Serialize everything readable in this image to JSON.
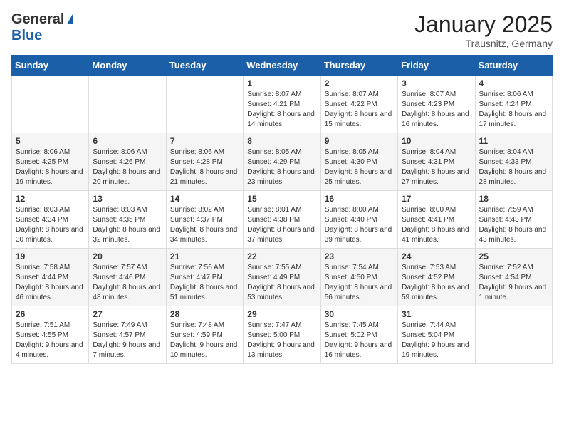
{
  "logo": {
    "general": "General",
    "blue": "Blue"
  },
  "title": "January 2025",
  "location": "Trausnitz, Germany",
  "days_header": [
    "Sunday",
    "Monday",
    "Tuesday",
    "Wednesday",
    "Thursday",
    "Friday",
    "Saturday"
  ],
  "weeks": [
    [
      {
        "num": "",
        "info": ""
      },
      {
        "num": "",
        "info": ""
      },
      {
        "num": "",
        "info": ""
      },
      {
        "num": "1",
        "info": "Sunrise: 8:07 AM\nSunset: 4:21 PM\nDaylight: 8 hours\nand 14 minutes."
      },
      {
        "num": "2",
        "info": "Sunrise: 8:07 AM\nSunset: 4:22 PM\nDaylight: 8 hours\nand 15 minutes."
      },
      {
        "num": "3",
        "info": "Sunrise: 8:07 AM\nSunset: 4:23 PM\nDaylight: 8 hours\nand 16 minutes."
      },
      {
        "num": "4",
        "info": "Sunrise: 8:06 AM\nSunset: 4:24 PM\nDaylight: 8 hours\nand 17 minutes."
      }
    ],
    [
      {
        "num": "5",
        "info": "Sunrise: 8:06 AM\nSunset: 4:25 PM\nDaylight: 8 hours\nand 19 minutes."
      },
      {
        "num": "6",
        "info": "Sunrise: 8:06 AM\nSunset: 4:26 PM\nDaylight: 8 hours\nand 20 minutes."
      },
      {
        "num": "7",
        "info": "Sunrise: 8:06 AM\nSunset: 4:28 PM\nDaylight: 8 hours\nand 21 minutes."
      },
      {
        "num": "8",
        "info": "Sunrise: 8:05 AM\nSunset: 4:29 PM\nDaylight: 8 hours\nand 23 minutes."
      },
      {
        "num": "9",
        "info": "Sunrise: 8:05 AM\nSunset: 4:30 PM\nDaylight: 8 hours\nand 25 minutes."
      },
      {
        "num": "10",
        "info": "Sunrise: 8:04 AM\nSunset: 4:31 PM\nDaylight: 8 hours\nand 27 minutes."
      },
      {
        "num": "11",
        "info": "Sunrise: 8:04 AM\nSunset: 4:33 PM\nDaylight: 8 hours\nand 28 minutes."
      }
    ],
    [
      {
        "num": "12",
        "info": "Sunrise: 8:03 AM\nSunset: 4:34 PM\nDaylight: 8 hours\nand 30 minutes."
      },
      {
        "num": "13",
        "info": "Sunrise: 8:03 AM\nSunset: 4:35 PM\nDaylight: 8 hours\nand 32 minutes."
      },
      {
        "num": "14",
        "info": "Sunrise: 8:02 AM\nSunset: 4:37 PM\nDaylight: 8 hours\nand 34 minutes."
      },
      {
        "num": "15",
        "info": "Sunrise: 8:01 AM\nSunset: 4:38 PM\nDaylight: 8 hours\nand 37 minutes."
      },
      {
        "num": "16",
        "info": "Sunrise: 8:00 AM\nSunset: 4:40 PM\nDaylight: 8 hours\nand 39 minutes."
      },
      {
        "num": "17",
        "info": "Sunrise: 8:00 AM\nSunset: 4:41 PM\nDaylight: 8 hours\nand 41 minutes."
      },
      {
        "num": "18",
        "info": "Sunrise: 7:59 AM\nSunset: 4:43 PM\nDaylight: 8 hours\nand 43 minutes."
      }
    ],
    [
      {
        "num": "19",
        "info": "Sunrise: 7:58 AM\nSunset: 4:44 PM\nDaylight: 8 hours\nand 46 minutes."
      },
      {
        "num": "20",
        "info": "Sunrise: 7:57 AM\nSunset: 4:46 PM\nDaylight: 8 hours\nand 48 minutes."
      },
      {
        "num": "21",
        "info": "Sunrise: 7:56 AM\nSunset: 4:47 PM\nDaylight: 8 hours\nand 51 minutes."
      },
      {
        "num": "22",
        "info": "Sunrise: 7:55 AM\nSunset: 4:49 PM\nDaylight: 8 hours\nand 53 minutes."
      },
      {
        "num": "23",
        "info": "Sunrise: 7:54 AM\nSunset: 4:50 PM\nDaylight: 8 hours\nand 56 minutes."
      },
      {
        "num": "24",
        "info": "Sunrise: 7:53 AM\nSunset: 4:52 PM\nDaylight: 8 hours\nand 59 minutes."
      },
      {
        "num": "25",
        "info": "Sunrise: 7:52 AM\nSunset: 4:54 PM\nDaylight: 9 hours\nand 1 minute."
      }
    ],
    [
      {
        "num": "26",
        "info": "Sunrise: 7:51 AM\nSunset: 4:55 PM\nDaylight: 9 hours\nand 4 minutes."
      },
      {
        "num": "27",
        "info": "Sunrise: 7:49 AM\nSunset: 4:57 PM\nDaylight: 9 hours\nand 7 minutes."
      },
      {
        "num": "28",
        "info": "Sunrise: 7:48 AM\nSunset: 4:59 PM\nDaylight: 9 hours\nand 10 minutes."
      },
      {
        "num": "29",
        "info": "Sunrise: 7:47 AM\nSunset: 5:00 PM\nDaylight: 9 hours\nand 13 minutes."
      },
      {
        "num": "30",
        "info": "Sunrise: 7:45 AM\nSunset: 5:02 PM\nDaylight: 9 hours\nand 16 minutes."
      },
      {
        "num": "31",
        "info": "Sunrise: 7:44 AM\nSunset: 5:04 PM\nDaylight: 9 hours\nand 19 minutes."
      },
      {
        "num": "",
        "info": ""
      }
    ]
  ]
}
